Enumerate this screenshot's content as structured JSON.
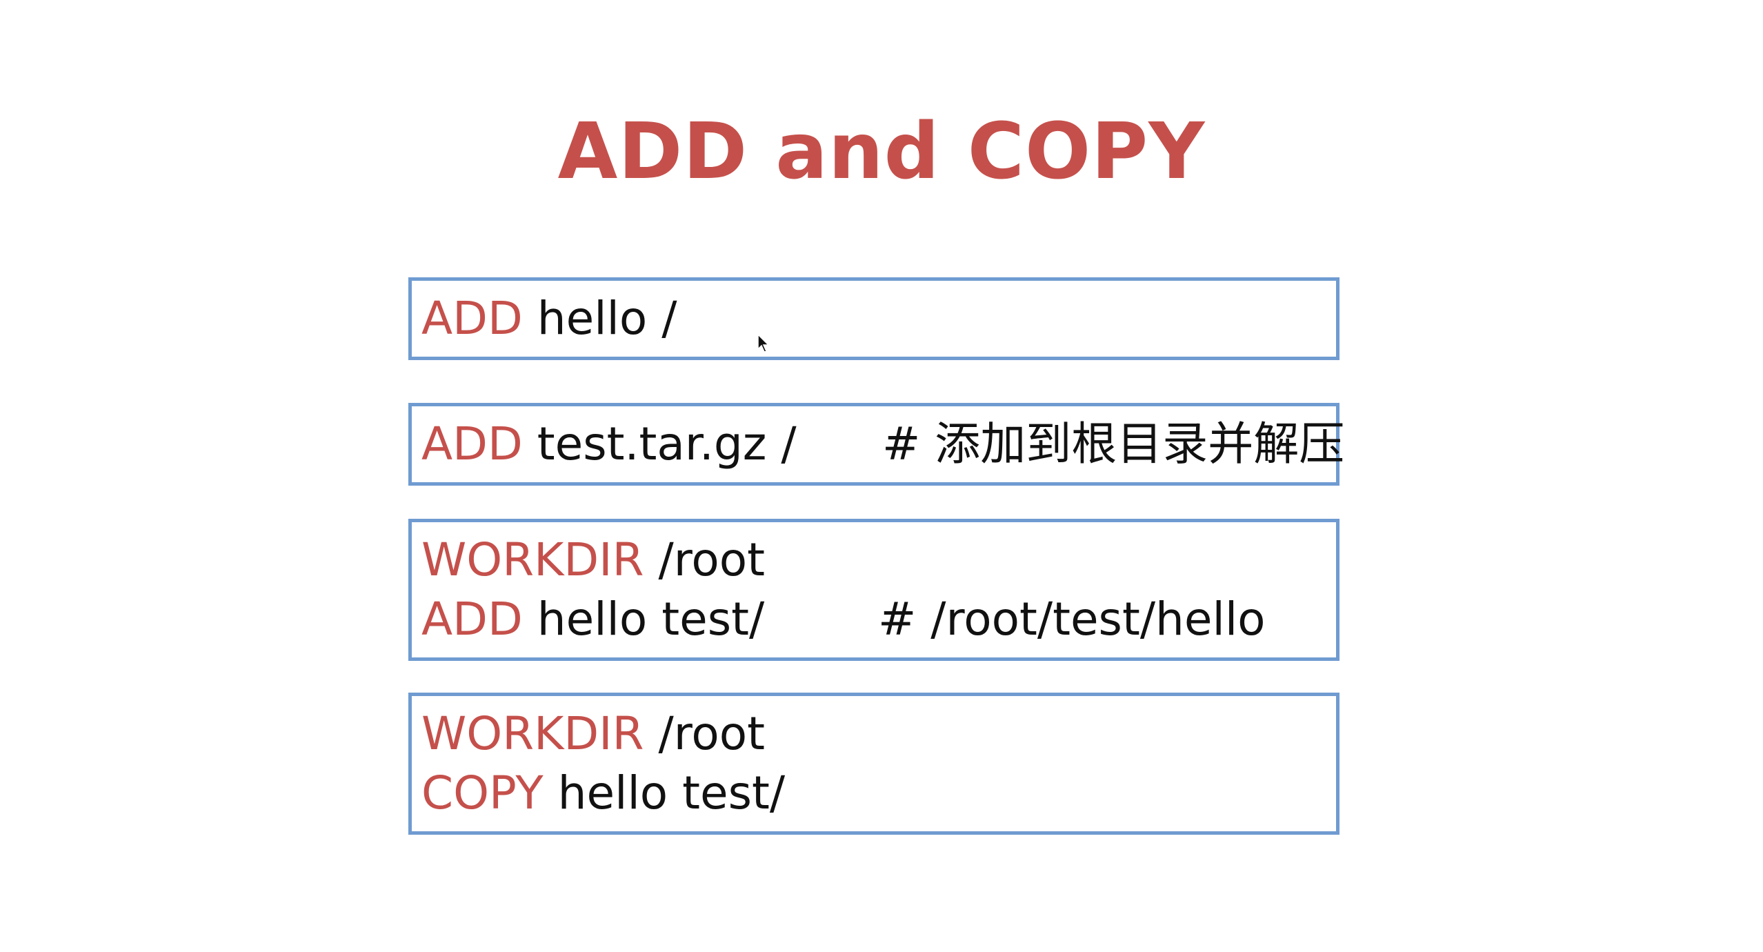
{
  "slide": {
    "title": "ADD and COPY",
    "colors": {
      "keyword": "#c5504b",
      "text": "#111111",
      "box_border": "#6f9bd1",
      "background": "#ffffff"
    },
    "blocks": [
      {
        "lines": [
          {
            "keyword": "ADD",
            "args": " hello /",
            "comment": ""
          }
        ]
      },
      {
        "lines": [
          {
            "keyword": "ADD",
            "args": " test.tar.gz /",
            "comment": "# 添加到根目录并解压"
          }
        ]
      },
      {
        "lines": [
          {
            "keyword": "WORKDIR",
            "args": " /root",
            "comment": ""
          },
          {
            "keyword": "ADD",
            "args": " hello test/",
            "comment": "# /root/test/hello"
          }
        ]
      },
      {
        "lines": [
          {
            "keyword": "WORKDIR",
            "args": " /root",
            "comment": ""
          },
          {
            "keyword": "COPY",
            "args": " hello test/",
            "comment": ""
          }
        ]
      }
    ],
    "cursor_icon": "mouse-pointer-icon"
  }
}
